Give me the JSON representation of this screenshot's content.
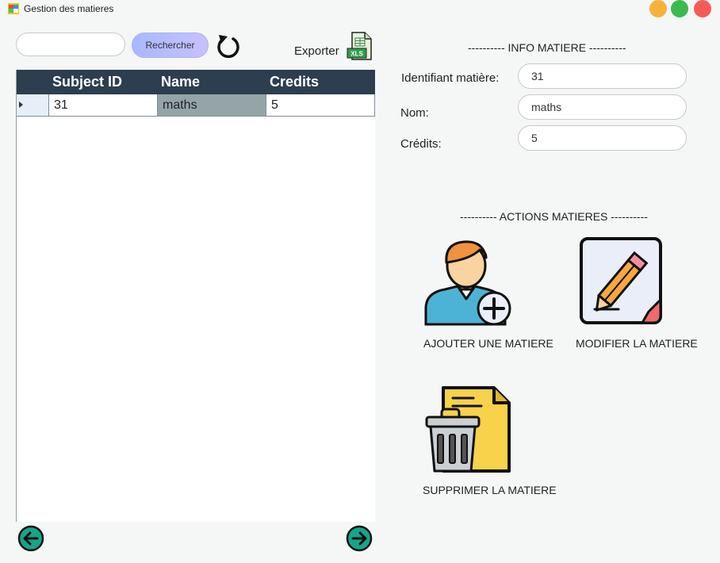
{
  "window": {
    "title": "Gestion des matieres",
    "controls": {
      "minimize_color": "#f6b23b",
      "maximize_color": "#3dba4e",
      "close_color": "#f45b58"
    }
  },
  "toolbar": {
    "search_value": "",
    "search_button": "Rechercher",
    "export_label": "Exporter",
    "xls_badge": "XLS"
  },
  "grid": {
    "columns": [
      "Subject ID",
      "Name",
      "Credits"
    ],
    "rows": [
      {
        "subject_id": "31",
        "name": "maths",
        "credits": "5"
      }
    ],
    "header_color": "#2c3e50",
    "selected_cell_color": "#95a5a6"
  },
  "info": {
    "section_title": "---------- INFO MATIERE ----------",
    "id_label": "Identifiant matière:",
    "id_value": "31",
    "name_label": "Nom:",
    "name_value": "maths",
    "credits_label": "Crédits:",
    "credits_value": "5"
  },
  "actions": {
    "section_title": "---------- ACTIONS MATIERES ----------",
    "add_label": "AJOUTER UNE MATIERE",
    "edit_label": "MODIFIER LA MATIERE",
    "delete_label": "SUPPRIMER LA MATIERE"
  },
  "navigation": {
    "accent_color": "#17a589"
  }
}
